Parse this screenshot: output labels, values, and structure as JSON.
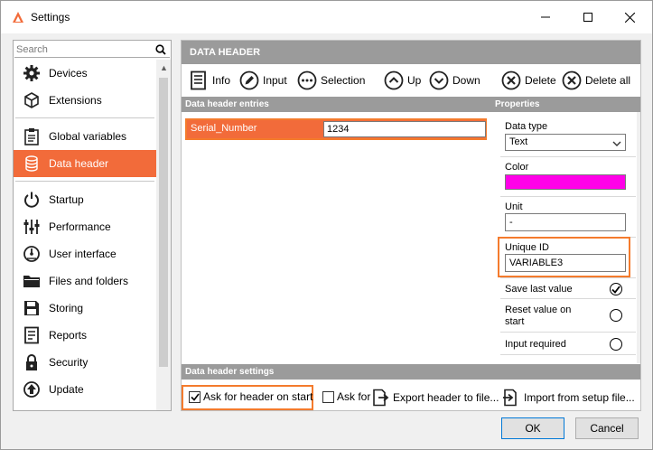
{
  "window": {
    "title": "Settings",
    "accent_color": "#f26b3a",
    "highlight_color": "#f47b2d"
  },
  "sidebar": {
    "search_placeholder": "Search",
    "groups": [
      [
        {
          "label": "Devices",
          "icon": "gear-icon"
        },
        {
          "label": "Extensions",
          "icon": "cube-icon"
        }
      ],
      [
        {
          "label": "Global variables",
          "icon": "clipboard-icon"
        },
        {
          "label": "Data header",
          "icon": "database-icon",
          "active": true
        }
      ],
      [
        {
          "label": "Startup",
          "icon": "power-icon"
        },
        {
          "label": "Performance",
          "icon": "sliders-icon"
        },
        {
          "label": "User interface",
          "icon": "gauge-icon"
        },
        {
          "label": "Files and folders",
          "icon": "folder-icon"
        },
        {
          "label": "Storing",
          "icon": "save-icon"
        },
        {
          "label": "Reports",
          "icon": "report-icon"
        },
        {
          "label": "Security",
          "icon": "lock-icon"
        },
        {
          "label": "Update",
          "icon": "update-icon"
        }
      ]
    ]
  },
  "main": {
    "header": "DATA HEADER",
    "toolbar": {
      "info": "Info",
      "input": "Input",
      "selection": "Selection",
      "up": "Up",
      "down": "Down",
      "delete": "Delete",
      "delete_all": "Delete all"
    },
    "entries_title": "Data header entries",
    "properties_title": "Properties",
    "entries": [
      {
        "name": "Serial_Number",
        "value": "1234"
      }
    ],
    "properties": {
      "data_type_label": "Data type",
      "data_type_value": "Text",
      "color_label": "Color",
      "color_value": "#ff00e8",
      "unit_label": "Unit",
      "unit_value": "-",
      "unique_id_label": "Unique ID",
      "unique_id_value": "VARIABLE3",
      "save_last_value_label": "Save last value",
      "save_last_value": true,
      "reset_value_label": "Reset value on start",
      "reset_value": false,
      "input_required_label": "Input required",
      "input_required": false
    },
    "settings_title": "Data header settings",
    "settings": {
      "ask_on_start_label": "Ask for header on start",
      "ask_on_start": true,
      "ask_for_label": "Ask for",
      "ask_for": false,
      "export_label": "Export header to file...",
      "import_label": "Import from setup file..."
    }
  },
  "footer": {
    "ok": "OK",
    "cancel": "Cancel"
  }
}
